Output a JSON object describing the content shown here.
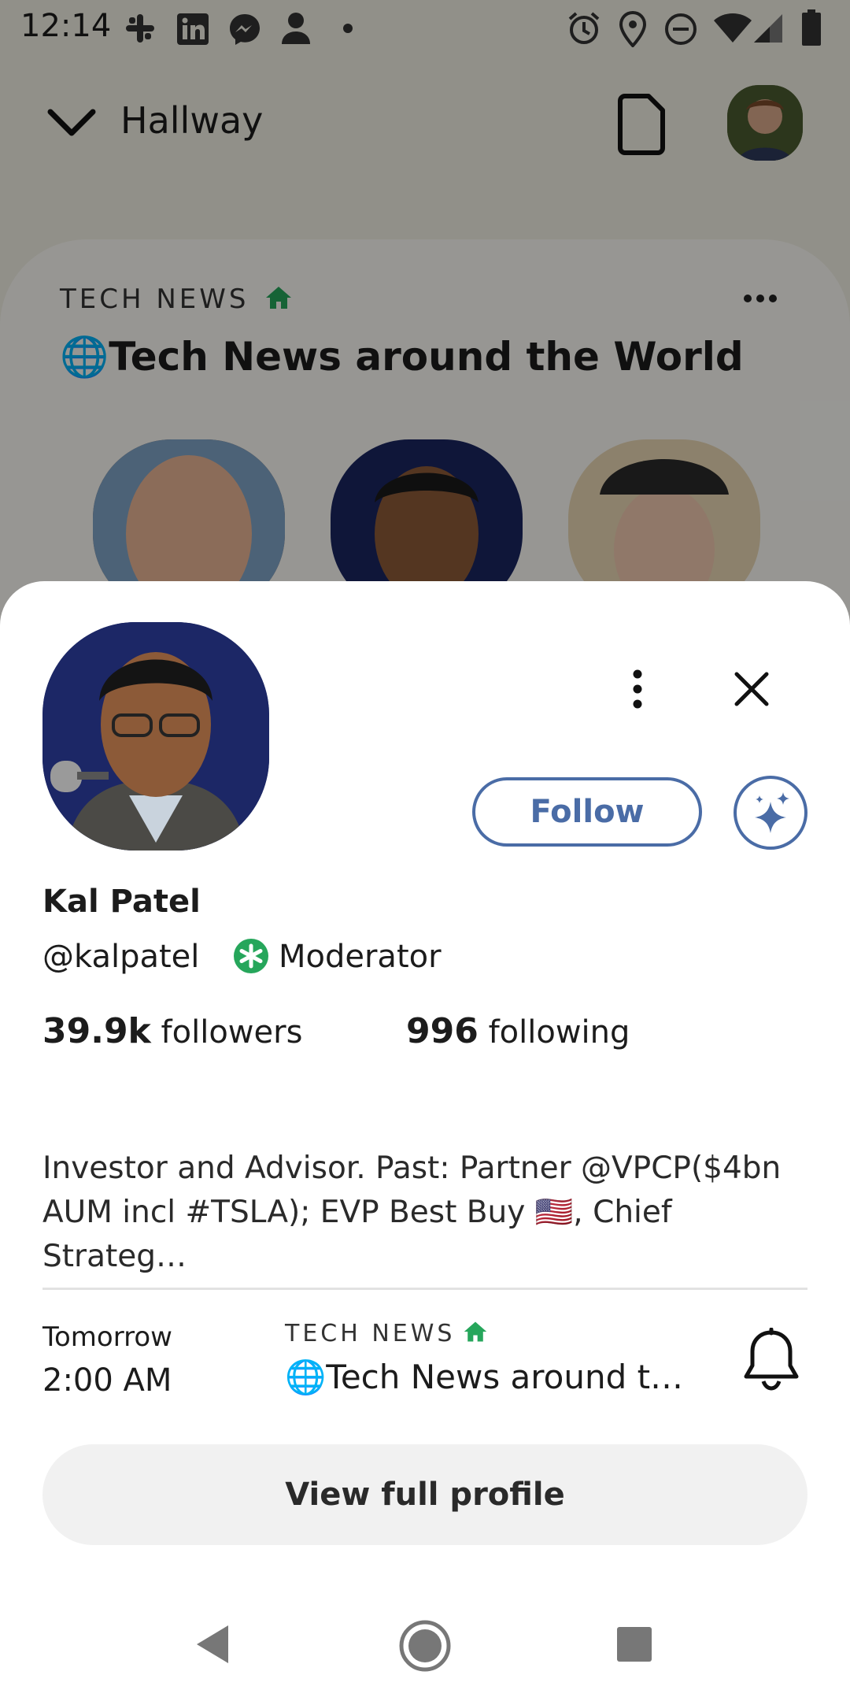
{
  "status_bar": {
    "time": "12:14",
    "left_icons": [
      "slack-icon",
      "linkedin-icon",
      "messenger-icon",
      "person-icon",
      "dot-icon"
    ],
    "right_icons": [
      "alarm-icon",
      "location-icon",
      "dnd-icon",
      "wifi-icon",
      "signal-icon",
      "battery-icon"
    ]
  },
  "header": {
    "back_icon": "chevron-down-icon",
    "title": "Hallway",
    "document_icon": "document-icon",
    "avatar": "user-avatar"
  },
  "room": {
    "club_label": "TECH NEWS",
    "club_icon": "house-icon",
    "title": "🌐Tech News around the World",
    "more_icon": "more-horizontal-icon",
    "speakers": [
      "speaker-avatar-1",
      "speaker-avatar-2",
      "speaker-avatar-3"
    ]
  },
  "profile": {
    "name": "Kal Patel",
    "handle": "@kalpatel",
    "role": "Moderator",
    "followers_count": "39.9k",
    "followers_label": "followers",
    "following_count": "996",
    "following_label": "following",
    "bio": "Investor and Advisor. Past: Partner @VPCP($4bn AUM incl #TSLA); EVP Best Buy 🇺🇸, Chief Strateg…",
    "follow_label": "Follow",
    "view_full_label": "View full profile"
  },
  "event": {
    "day": "Tomorrow",
    "time": "2:00 AM",
    "club_label": "TECH NEWS",
    "title": "🌐Tech News around t…"
  },
  "colors": {
    "accent": "#4a6ca6",
    "club_green": "#26a65b",
    "dim_overlay": "rgba(0,0,0,0.40)"
  }
}
